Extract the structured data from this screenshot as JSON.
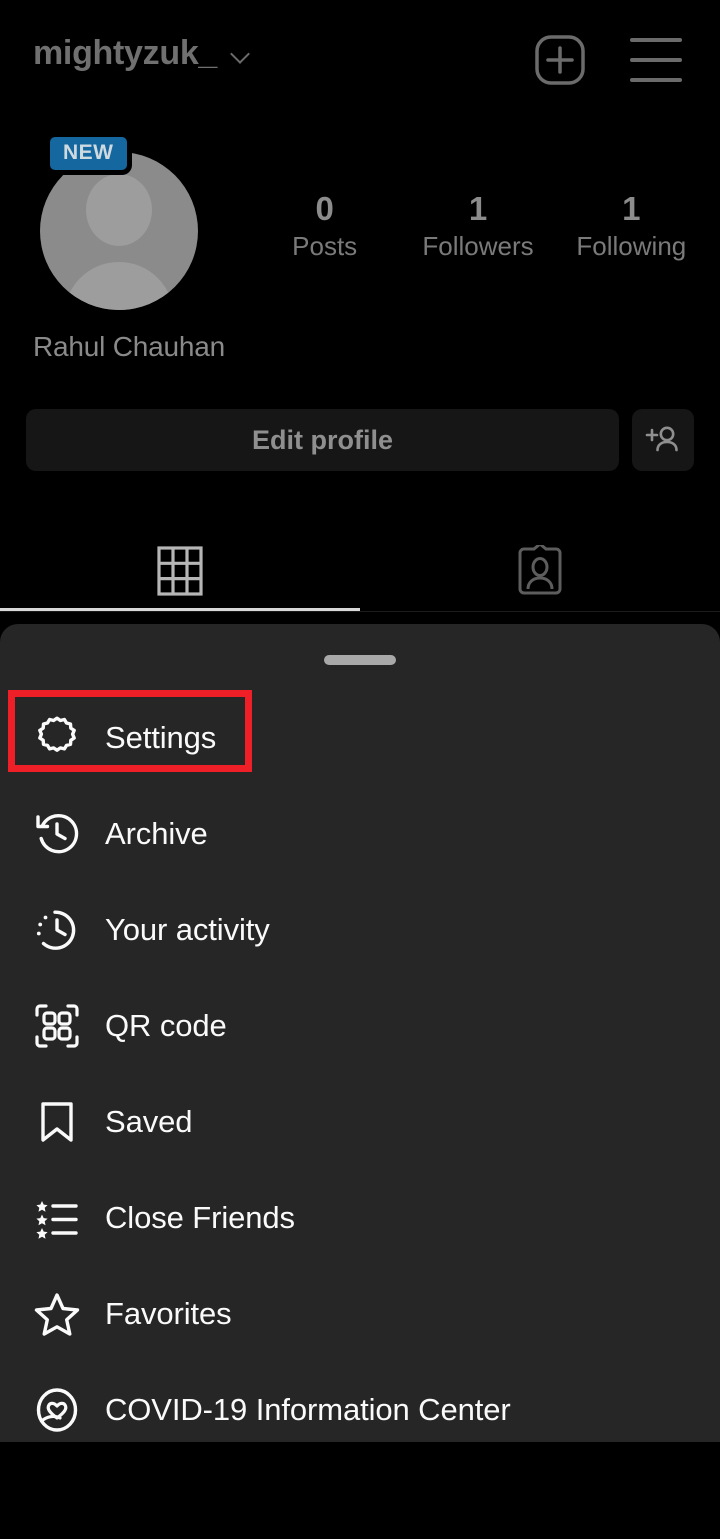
{
  "header": {
    "username": "mightyzuk_",
    "dropdown_icon": "chevron-down-icon",
    "new_post_icon": "plus-square-icon",
    "menu_icon": "hamburger-icon"
  },
  "profile": {
    "avatar_icon": "default-avatar-icon",
    "badge": "NEW",
    "display_name": "Rahul Chauhan",
    "stats": [
      {
        "value": "0",
        "label": "Posts"
      },
      {
        "value": "1",
        "label": "Followers"
      },
      {
        "value": "1",
        "label": "Following"
      }
    ],
    "edit_profile_label": "Edit profile",
    "add_person_icon": "add-person-icon"
  },
  "tabs": [
    {
      "name": "grid",
      "icon": "grid-icon",
      "active": true
    },
    {
      "name": "tagged",
      "icon": "tagged-person-icon",
      "active": false
    }
  ],
  "sheet": {
    "handle": "drag-handle",
    "items": [
      {
        "label": "Settings",
        "icon": "gear-icon",
        "highlighted": true
      },
      {
        "label": "Archive",
        "icon": "archive-clock-icon",
        "highlighted": false
      },
      {
        "label": "Your activity",
        "icon": "activity-clock-icon",
        "highlighted": false
      },
      {
        "label": "QR code",
        "icon": "qr-code-icon",
        "highlighted": false
      },
      {
        "label": "Saved",
        "icon": "bookmark-icon",
        "highlighted": false
      },
      {
        "label": "Close Friends",
        "icon": "star-list-icon",
        "highlighted": false
      },
      {
        "label": "Favorites",
        "icon": "star-icon",
        "highlighted": false
      },
      {
        "label": "COVID-19 Information Center",
        "icon": "covid-heart-icon",
        "highlighted": false
      }
    ]
  },
  "colors": {
    "background": "#000000",
    "sheet_background": "#262626",
    "highlight_red": "#ee1f26",
    "badge_blue": "#15679f",
    "label_white": "#fafafa",
    "muted_gray": "#7a7a7a"
  }
}
